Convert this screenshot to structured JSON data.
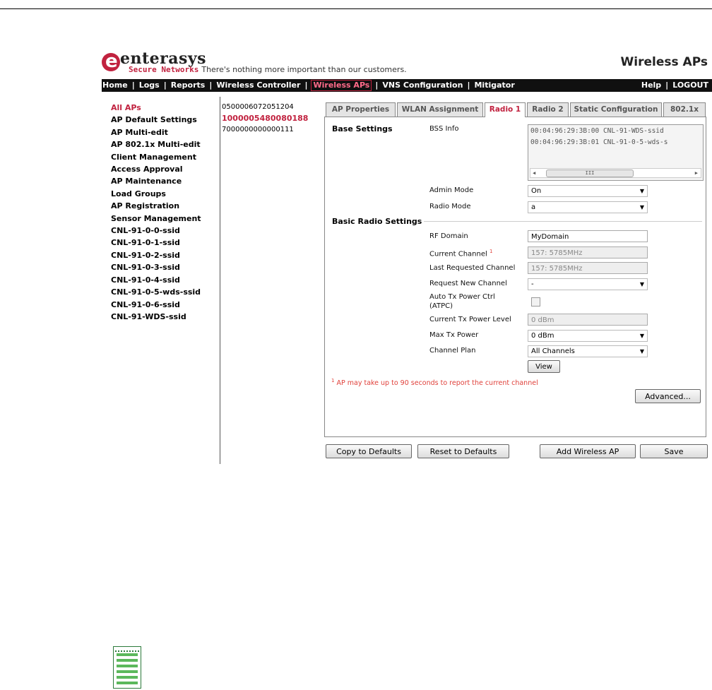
{
  "header": {
    "logo_letter": "e",
    "brand": "enterasys",
    "brand_sub": "Secure Networks",
    "tagline": "There's nothing more important than our customers.",
    "page_title": "Wireless APs"
  },
  "nav": {
    "items": [
      "Home",
      "Logs",
      "Reports",
      "Wireless Controller",
      "Wireless APs",
      "VNS Configuration",
      "Mitigator"
    ],
    "active": "Wireless APs",
    "help": "Help",
    "logout": "LOGOUT"
  },
  "sidebar": {
    "items": [
      "All APs",
      "AP Default Settings",
      "AP Multi-edit",
      "AP 802.1x Multi-edit",
      "Client Management",
      "Access Approval",
      "AP Maintenance",
      "Load Groups",
      "AP Registration",
      "Sensor Management",
      "CNL-91-0-0-ssid",
      "CNL-91-0-1-ssid",
      "CNL-91-0-2-ssid",
      "CNL-91-0-3-ssid",
      "CNL-91-0-4-ssid",
      "CNL-91-0-5-wds-ssid",
      "CNL-91-0-6-ssid",
      "CNL-91-WDS-ssid"
    ]
  },
  "aplist": {
    "items": [
      "0500006072051204",
      "1000005480080188",
      "7000000000000111"
    ]
  },
  "tabs": {
    "items": [
      "AP Properties",
      "WLAN Assignment",
      "Radio 1",
      "Radio 2",
      "Static Configuration",
      "802.1x"
    ],
    "active": "Radio 1"
  },
  "form": {
    "base_settings": "Base Settings",
    "bss_info_label": "BSS Info",
    "bss_rows": [
      "00:04:96:29:3B:00  CNL-91-WDS-ssid",
      "00:04:96:29:3B:01  CNL-91-0-5-wds-s"
    ],
    "scroll_thumb": "III",
    "admin_mode_label": "Admin Mode",
    "admin_mode_value": "On",
    "radio_mode_label": "Radio Mode",
    "radio_mode_value": "a",
    "basic_radio_settings": "Basic Radio Settings",
    "rf_domain_label": "RF Domain",
    "rf_domain_value": "MyDomain",
    "current_channel_label": "Current Channel",
    "current_channel_sup": "1",
    "current_channel_value": "157: 5785MHz",
    "last_requested_channel_label": "Last Requested Channel",
    "last_requested_channel_value": "157: 5785MHz",
    "request_new_channel_label": "Request New Channel",
    "request_new_channel_value": "-",
    "atpc_label_line1": "Auto Tx Power Ctrl",
    "atpc_label_line2": "(ATPC)",
    "current_tx_power_label": "Current Tx Power Level",
    "current_tx_power_value": "0 dBm",
    "max_tx_power_label": "Max Tx Power",
    "max_tx_power_value": "0 dBm",
    "channel_plan_label": "Channel Plan",
    "channel_plan_value": "All Channels",
    "view_button": "View",
    "note_sup": "1",
    "note_text": "AP may take up to 90 seconds to report the current channel",
    "advanced_button": "Advanced..."
  },
  "actions": {
    "copy_to_defaults": "Copy to Defaults",
    "reset_to_defaults": "Reset to Defaults",
    "add_wireless_ap": "Add Wireless AP",
    "save": "Save"
  },
  "colors": {
    "accent": "#c1223f",
    "nav_bg": "#101010",
    "note": "#e0413b",
    "notepad": "#2b7a3a"
  }
}
